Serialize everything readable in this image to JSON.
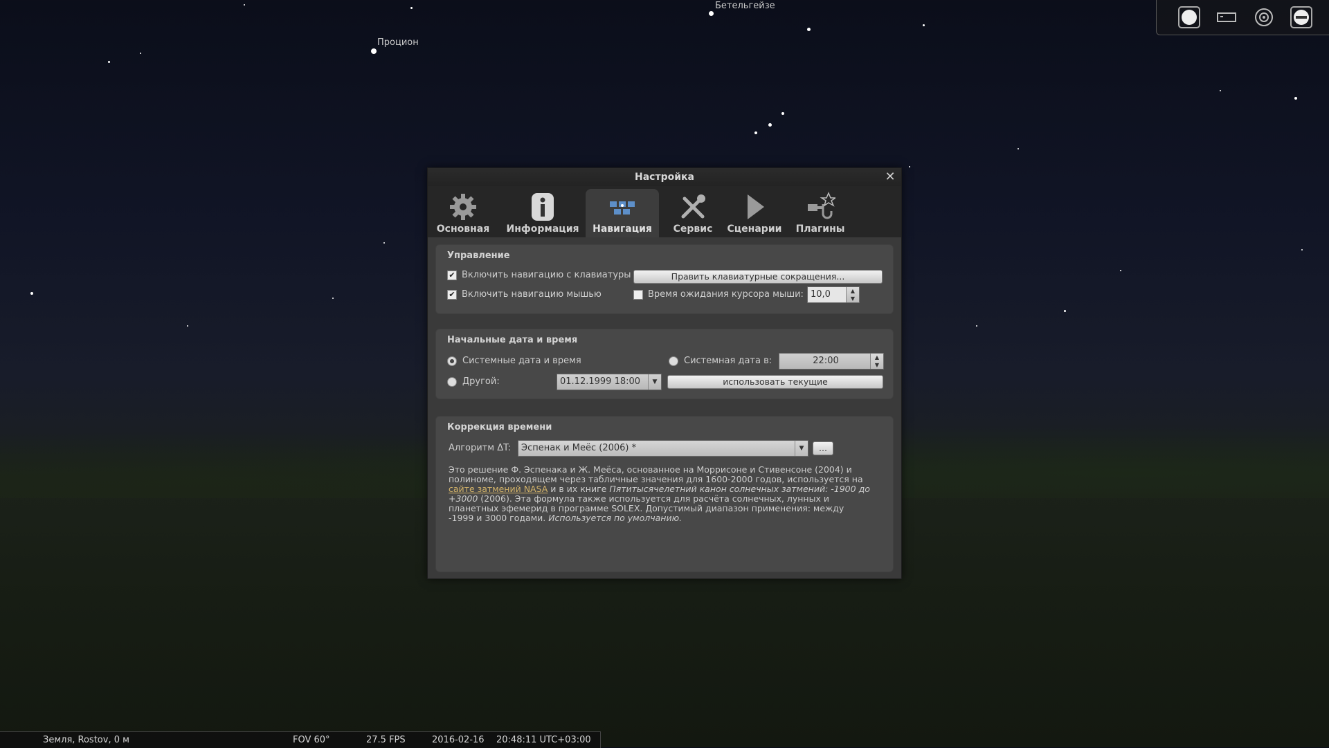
{
  "sky": {
    "labels": [
      "Бетельгейзе",
      "Процион"
    ]
  },
  "toolbar": {
    "icons": [
      "circle-filled-icon",
      "rectangle-icon",
      "target-icon",
      "exit-icon"
    ]
  },
  "dialog": {
    "title": "Настройка",
    "close_label": "✕",
    "tabs": [
      {
        "label": "Основная",
        "icon": "gear-icon"
      },
      {
        "label": "Информация",
        "icon": "info-icon"
      },
      {
        "label": "Навигация",
        "icon": "navigation-icon"
      },
      {
        "label": "Сервис",
        "icon": "tools-icon"
      },
      {
        "label": "Сценарии",
        "icon": "play-icon"
      },
      {
        "label": "Плагины",
        "icon": "plugin-icon"
      }
    ],
    "active_tab": "Навигация",
    "control": {
      "title": "Управление",
      "keyboard_nav_label": "Включить навигацию с клавиатуры",
      "keyboard_nav_checked": true,
      "shortcuts_button": "Править клавиатурные сокращения...",
      "mouse_nav_label": "Включить навигацию мышью",
      "mouse_nav_checked": true,
      "cursor_timeout_label": "Время ожидания курсора мыши:",
      "cursor_timeout_checked": false,
      "cursor_timeout_value": "10,0"
    },
    "startup": {
      "title": "Начальные дата и время",
      "system_datetime_label": "Системные дата и время",
      "system_date_at_label": "Системная дата в:",
      "system_date_at_value": "22:00",
      "other_label": "Другой:",
      "other_value": "01.12.1999 18:00",
      "use_current_button": "использовать текущие",
      "selected": "system_datetime"
    },
    "delta_t": {
      "title": "Коррекция времени",
      "algorithm_label": "Алгоритм ΔT:",
      "algorithm_value": "Эспенак и Меёс (2006) *",
      "more_button": "...",
      "desc_1": "Это решение Ф. Эспенака и Ж. Меёса, основанное на Моррисоне и Стивенсоне (2004) и полиноме, проходящем через табличные значения для 1600-2000 годов, используется на ",
      "desc_link": "сайте затмений NASA",
      "desc_2": " и в их книге ",
      "desc_italic": "Пятитысячелетний канон солнечных затмений: -1900 до +3000",
      "desc_3": " (2006). Эта формула также используется для расчёта солнечных, лунных и планетных эфемерид в программе SOLEX. Допустимый диапазон применения: между -1999 и 3000 годами. ",
      "desc_italic_2": "Используется по умолчанию."
    }
  },
  "status_bar": {
    "location": "Земля, Rostov, 0 м",
    "fov": "FOV 60°",
    "fps": "27.5 FPS",
    "date": "2016-02-16",
    "time": "20:48:11 UTC+03:00"
  }
}
